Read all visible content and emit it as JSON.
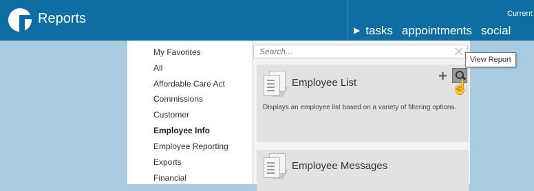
{
  "app": {
    "title": "Reports",
    "current_label": "Current"
  },
  "nav": {
    "items": [
      "tasks",
      "appointments",
      "social"
    ]
  },
  "sidebar": {
    "items": [
      "My Favorites",
      "All",
      "Affordable Care Act",
      "Commissions",
      "Customer",
      "Employee Info",
      "Employee Reporting",
      "Exports",
      "Financial"
    ],
    "active": "Employee Info"
  },
  "search": {
    "placeholder": "Search..."
  },
  "reports": [
    {
      "title": "Employee List",
      "description": "Displays an employee list based on a variety of filtering options."
    },
    {
      "title": "Employee Messages",
      "description": ""
    }
  ],
  "tooltip": {
    "text": "View Report"
  },
  "icons": {
    "add": "plus-icon",
    "view": "magnifier-icon",
    "cursor": "hand-cursor-icon",
    "clear": "close-icon"
  },
  "colors": {
    "header": "#0e6da3",
    "background": "#a9cbe0",
    "card": "#e2e2e2"
  }
}
